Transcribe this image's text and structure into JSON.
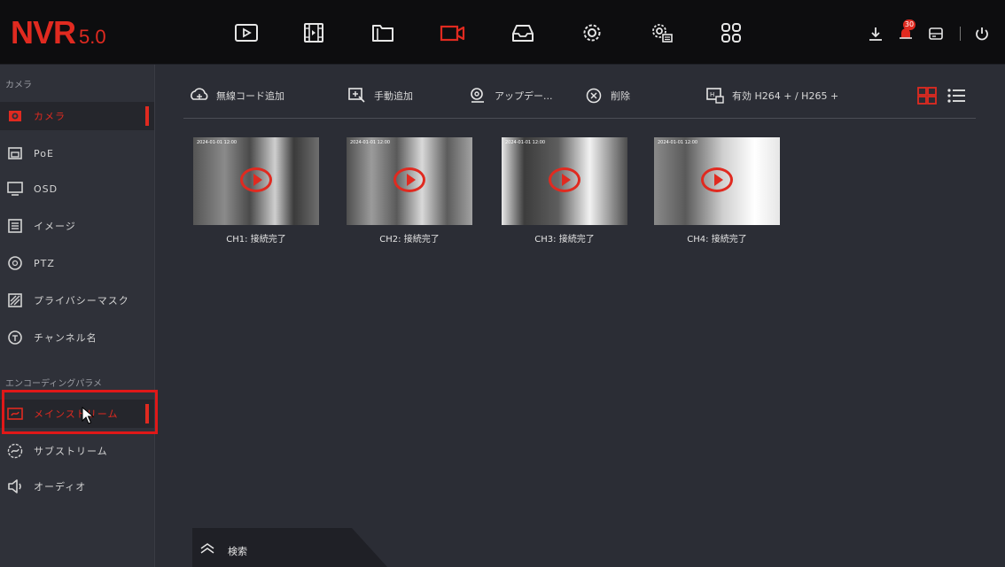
{
  "app": {
    "logo_main": "NVR",
    "logo_version": "5.0"
  },
  "top_nav": {
    "icons": [
      "playback-icon",
      "video-clip-icon",
      "folder-icon",
      "camera-icon",
      "storage-icon",
      "settings-icon",
      "system-settings-icon",
      "apps-grid-icon"
    ],
    "active": "camera-icon",
    "right_icons": [
      "download-icon",
      "alarm-icon",
      "disk-icon",
      "power-icon"
    ],
    "alarm_count": "30"
  },
  "sidebar": {
    "section1_title": "カメラ",
    "section1_items": [
      {
        "label": "カメラ",
        "icon": "camera-icon",
        "active": true
      },
      {
        "label": "PoE",
        "icon": "poe-icon"
      },
      {
        "label": "OSD",
        "icon": "monitor-icon"
      },
      {
        "label": "イメージ",
        "icon": "image-settings-icon"
      },
      {
        "label": "PTZ",
        "icon": "ptz-icon"
      },
      {
        "label": "プライバシーマスク",
        "icon": "privacy-mask-icon"
      },
      {
        "label": "チャンネル名",
        "icon": "channel-name-icon"
      }
    ],
    "section2_title": "エンコーディングパラメ",
    "section2_items": [
      {
        "label": "メインストリーム",
        "icon": "main-stream-icon",
        "active": true
      },
      {
        "label": "サブストリーム",
        "icon": "sub-stream-icon"
      },
      {
        "label": "オーディオ",
        "icon": "audio-icon"
      }
    ]
  },
  "toolbar": {
    "wireless_add": "無線コード追加",
    "manual_add": "手動追加",
    "update": "アップデー...",
    "delete": "削除",
    "codec": "有効 H264 + / H265 +"
  },
  "channels": [
    {
      "caption": "CH1: 接続完了",
      "timestamp": "2024-01-01 12:00"
    },
    {
      "caption": "CH2: 接続完了",
      "timestamp": "2024-01-01 12:00"
    },
    {
      "caption": "CH3: 接続完了",
      "timestamp": "2024-01-01 12:00"
    },
    {
      "caption": "CH4: 接続完了",
      "timestamp": "2024-01-01 12:00"
    }
  ],
  "search": {
    "label": "検索"
  },
  "colors": {
    "accent": "#e02a20",
    "background": "#2b2d35",
    "topbar": "#0d0d0f",
    "sidebar": "#2f3139"
  }
}
